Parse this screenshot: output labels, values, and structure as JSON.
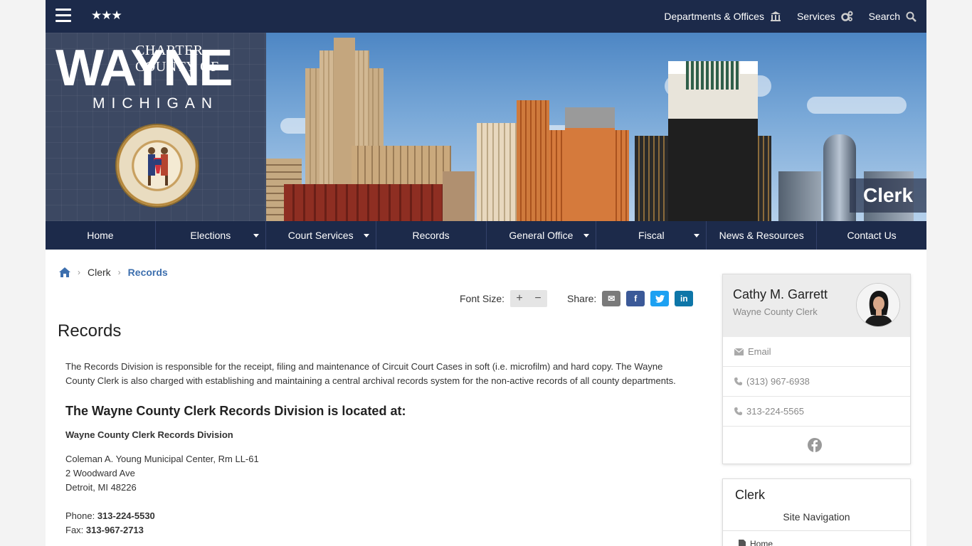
{
  "topbar": {
    "stars": "★★★",
    "links": [
      {
        "label": "Departments & Offices",
        "icon": "building-icon"
      },
      {
        "label": "Services",
        "icon": "gears-icon"
      },
      {
        "label": "Search",
        "icon": "search-icon"
      }
    ]
  },
  "banner": {
    "logo_charter": "CHARTER COUNTY OF",
    "logo_wayne": "WAYNE",
    "logo_michigan": "MICHIGAN",
    "section_tag": "Clerk"
  },
  "mainnav": {
    "items": [
      {
        "label": "Home",
        "dropdown": false
      },
      {
        "label": "Elections",
        "dropdown": true
      },
      {
        "label": "Court Services",
        "dropdown": true
      },
      {
        "label": "Records",
        "dropdown": false
      },
      {
        "label": "General Office",
        "dropdown": true
      },
      {
        "label": "Fiscal",
        "dropdown": true
      },
      {
        "label": "News & Resources",
        "dropdown": false
      },
      {
        "label": "Contact Us",
        "dropdown": false
      }
    ]
  },
  "breadcrumb": {
    "parent": "Clerk",
    "current": "Records"
  },
  "tools": {
    "font_size_label": "Font Size:",
    "increase": "+",
    "decrease": "−",
    "share_label": "Share:",
    "share_buttons": [
      {
        "name": "email",
        "glyph": "✉",
        "color": "#7a7a7a"
      },
      {
        "name": "facebook",
        "glyph": "f",
        "color": "#3b5998"
      },
      {
        "name": "twitter",
        "glyph": "t",
        "color": "#1da1f2"
      },
      {
        "name": "linkedin",
        "glyph": "in",
        "color": "#0e76a8"
      }
    ]
  },
  "page_title": "Records",
  "content": {
    "intro": "The Records Division is responsible for the receipt, filing and maintenance of Circuit Court Cases in soft (i.e. microfilm) and hard copy. The Wayne County Clerk is also charged with establishing and maintaining a central archival records system for the non-active records of all county departments.",
    "heading": "The Wayne County Clerk Records Division is located at:",
    "office_name": "Wayne County Clerk Records Division",
    "address": [
      "Coleman A. Young Municipal Center, Rm LL-61",
      "2 Woodward Ave",
      "Detroit, MI 48226"
    ],
    "phone_label": "Phone:",
    "phone": "313-224-5530",
    "fax_label": "Fax:",
    "fax": "313-967-2713"
  },
  "official": {
    "name": "Cathy M. Garrett",
    "role": "Wayne County Clerk",
    "email_label": "Email",
    "phone1": "(313) 967-6938",
    "phone2": "313-224-5565"
  },
  "sitenav": {
    "title": "Clerk",
    "subtitle": "Site Navigation",
    "first_item": "Home"
  }
}
